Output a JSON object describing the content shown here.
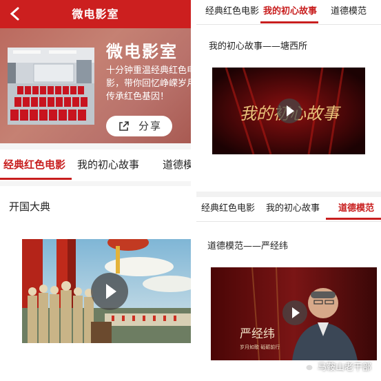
{
  "left": {
    "header_title": "微电影室",
    "hero": {
      "title": "微电影室",
      "desc_lines": [
        "十分钟重温经典红色电",
        "影，带你回忆峥嵘岁月",
        "传承红色基因！"
      ],
      "share_label": "分享"
    },
    "tabs": [
      "经典红色电影",
      "我的初心故事",
      "道德模"
    ],
    "active_tab": 0,
    "item": {
      "title": "开国大典"
    }
  },
  "right_top": {
    "tabs": [
      "经典红色电影",
      "我的初心故事",
      "道德模范"
    ],
    "active_tab": 1,
    "item": {
      "title": "我的初心故事——塘西所",
      "caption": "我的初心故事"
    }
  },
  "right_bottom": {
    "tabs": [
      "经典红色电影",
      "我的初心故事",
      "道德模范"
    ],
    "active_tab": 2,
    "item": {
      "title": "道德模范——严经纬",
      "caption_name": "严经纬",
      "caption_sub": "岁月如歌 砥砺前行"
    }
  },
  "watermark": "马鞍山老干部",
  "colors": {
    "brand_red": "#cc1f1f",
    "tab_active": "#c81e1e"
  }
}
